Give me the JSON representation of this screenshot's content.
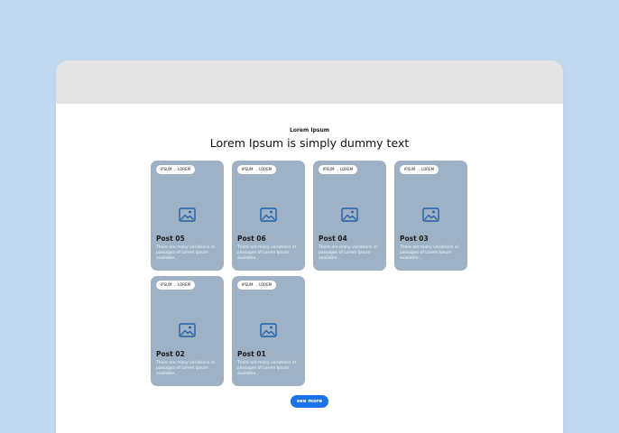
{
  "section": {
    "eyebrow": "Lorem Ipsum",
    "heading": "Lorem Ipsum is simply dummy text"
  },
  "tag": {
    "first": "IPSUM",
    "separator": "..",
    "second": "LOREM"
  },
  "posts": [
    {
      "title": "Post 05",
      "desc": "There are many variations of passages of Lorem Ipsum available..."
    },
    {
      "title": "Post 06",
      "desc": "There are many variations of passages of Lorem Ipsum available..."
    },
    {
      "title": "Post 04",
      "desc": "There are many variations of passages of Lorem Ipsum available..."
    },
    {
      "title": "Post 03",
      "desc": "There are many variations of passages of Lorem Ipsum available..."
    },
    {
      "title": "Post 02",
      "desc": "There are many variations of passages of Lorem Ipsum available..."
    },
    {
      "title": "Post 01",
      "desc": "There are many variations of passages of Lorem Ipsum available..."
    }
  ],
  "actions": {
    "see_more": "see more"
  },
  "colors": {
    "background": "#c3d9ef",
    "titlebar": "#e4e4e4",
    "card": "#9fb2c5",
    "icon": "#1f5fa8",
    "button": "#1a73e8"
  }
}
